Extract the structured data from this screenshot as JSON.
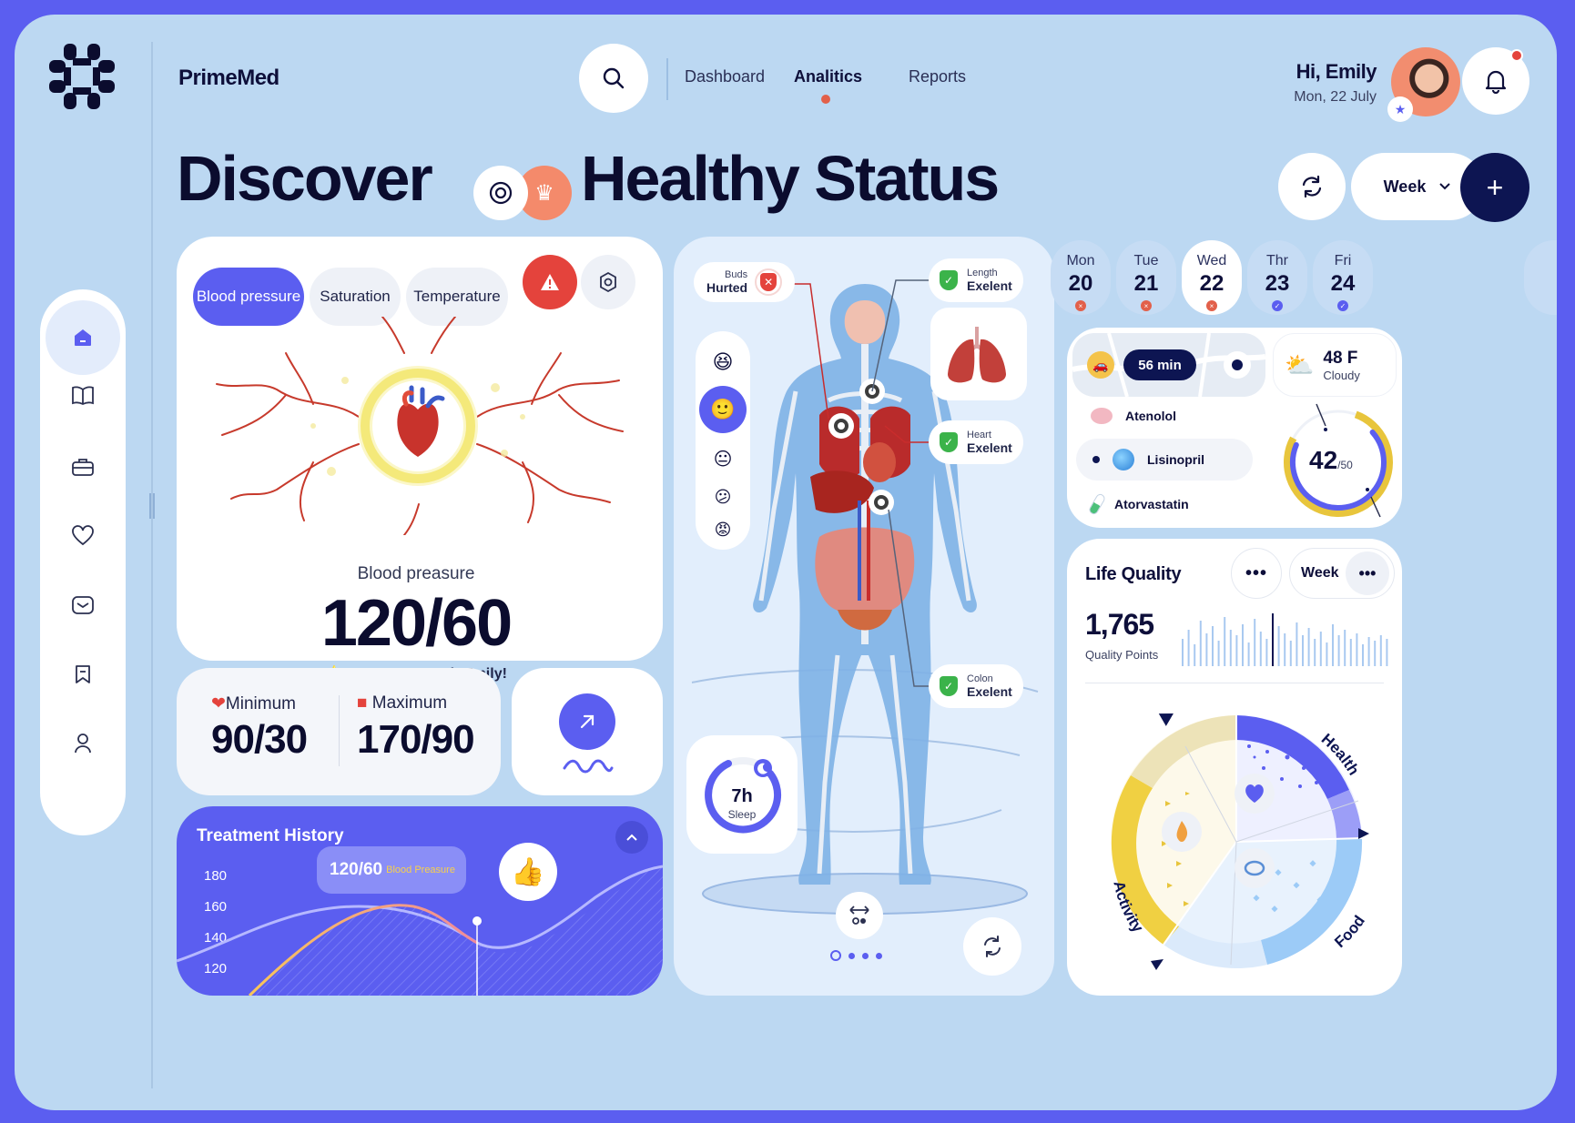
{
  "app": {
    "name": "PrimeMed"
  },
  "nav": {
    "items": [
      "Dashboard",
      "Analitics",
      "Reports"
    ],
    "active": "Analitics"
  },
  "user": {
    "greeting": "Hi, Emily",
    "date": "Mon, 22 July"
  },
  "heading": {
    "part1": "Discover",
    "part2": "Healthy Status"
  },
  "controls": {
    "period": "Week"
  },
  "tabs": [
    "Blood pressure",
    "Saturation",
    "Temperature"
  ],
  "blood": {
    "label": "Blood preasure",
    "value": "120/60",
    "message": "It’s a great result Emily!"
  },
  "range": {
    "min_label": "Minimum",
    "min_value": "90/30",
    "max_label": "Maximum",
    "max_value": "170/90"
  },
  "treatment": {
    "title": "Treatment History",
    "ticks": [
      "180",
      "160",
      "140",
      "120"
    ],
    "tooltip_value": "120/60",
    "tooltip_label": "Blood Preasure"
  },
  "organs": [
    {
      "small": "Buds",
      "status": "Hurted",
      "state": "bad"
    },
    {
      "small": "Length",
      "status": "Exelent",
      "state": "good"
    },
    {
      "small": "Heart",
      "status": "Exelent",
      "state": "good"
    },
    {
      "small": "Colon",
      "status": "Exelent",
      "state": "good"
    }
  ],
  "moods": [
    "😆",
    "🙂",
    "😐",
    "😕",
    "😡"
  ],
  "sleep": {
    "value": "7h",
    "label": "Sleep"
  },
  "pager": {
    "pages": 4,
    "active": 0
  },
  "days": [
    {
      "name": "Mon",
      "num": "20",
      "status": "missed"
    },
    {
      "name": "Tue",
      "num": "21",
      "status": "missed"
    },
    {
      "name": "Wed",
      "num": "22",
      "status": "missed",
      "selected": true
    },
    {
      "name": "Thr",
      "num": "23",
      "status": "done"
    },
    {
      "name": "Fri",
      "num": "24",
      "status": "done"
    }
  ],
  "travel": {
    "duration": "56 min"
  },
  "weather": {
    "temp": "48 F",
    "desc": "Cloudy"
  },
  "meds": [
    "Atenolol",
    "Lisinopril",
    "Atorvastatin"
  ],
  "dose": {
    "value": "42",
    "total": "/50",
    "fraction": 0.84
  },
  "life": {
    "title": "Life Quality",
    "period": "Week",
    "points": "1,765",
    "points_label": "Quality Points",
    "segments": [
      "Health",
      "Food",
      "Activity"
    ]
  },
  "colors": {
    "accent": "#5b5ef0",
    "navy": "#0d1552",
    "yellow": "#e8c53c",
    "danger": "#e4433c",
    "good": "#3bb34a"
  }
}
